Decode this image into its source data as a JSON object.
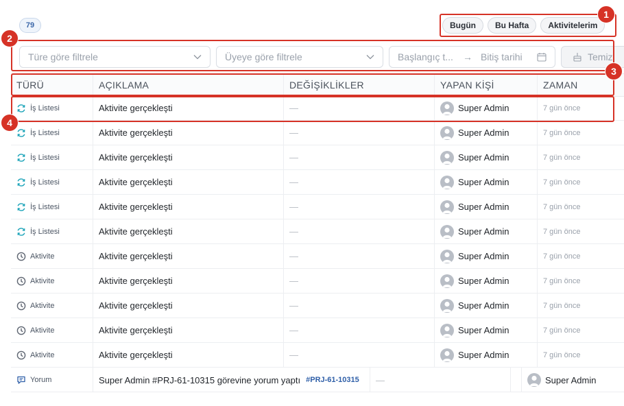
{
  "count_badge": "79",
  "quick_filters": [
    "Bugün",
    "Bu Hafta",
    "Aktivitelerim"
  ],
  "filters": {
    "type_placeholder": "Türe göre filtrele",
    "member_placeholder": "Üyeye göre filtrele",
    "start_date_placeholder": "Başlangıç t...",
    "end_date_placeholder": "Bitiş tarihi",
    "clear_label": "Temiz"
  },
  "table": {
    "headers": [
      "TÜRÜ",
      "AÇIKLAMA",
      "DEĞİŞİKLİKLER",
      "YAPAN KİŞİ",
      "ZAMAN"
    ],
    "rows": [
      {
        "type": "İş Listesi",
        "icon": "refresh-icon",
        "desc": "Aktivite gerçekleşti",
        "changes": "—",
        "user": "Super Admin",
        "time": "7 gün önce"
      },
      {
        "type": "İş Listesi",
        "icon": "refresh-icon",
        "desc": "Aktivite gerçekleşti",
        "changes": "—",
        "user": "Super Admin",
        "time": "7 gün önce"
      },
      {
        "type": "İş Listesi",
        "icon": "refresh-icon",
        "desc": "Aktivite gerçekleşti",
        "changes": "—",
        "user": "Super Admin",
        "time": "7 gün önce"
      },
      {
        "type": "İş Listesi",
        "icon": "refresh-icon",
        "desc": "Aktivite gerçekleşti",
        "changes": "—",
        "user": "Super Admin",
        "time": "7 gün önce"
      },
      {
        "type": "İş Listesi",
        "icon": "refresh-icon",
        "desc": "Aktivite gerçekleşti",
        "changes": "—",
        "user": "Super Admin",
        "time": "7 gün önce"
      },
      {
        "type": "İş Listesi",
        "icon": "refresh-icon",
        "desc": "Aktivite gerçekleşti",
        "changes": "—",
        "user": "Super Admin",
        "time": "7 gün önce"
      },
      {
        "type": "Aktivite",
        "icon": "clock-icon",
        "desc": "Aktivite gerçekleşti",
        "changes": "—",
        "user": "Super Admin",
        "time": "7 gün önce"
      },
      {
        "type": "Aktivite",
        "icon": "clock-icon",
        "desc": "Aktivite gerçekleşti",
        "changes": "—",
        "user": "Super Admin",
        "time": "7 gün önce"
      },
      {
        "type": "Aktivite",
        "icon": "clock-icon",
        "desc": "Aktivite gerçekleşti",
        "changes": "—",
        "user": "Super Admin",
        "time": "7 gün önce"
      },
      {
        "type": "Aktivite",
        "icon": "clock-icon",
        "desc": "Aktivite gerçekleşti",
        "changes": "—",
        "user": "Super Admin",
        "time": "7 gün önce"
      },
      {
        "type": "Aktivite",
        "icon": "clock-icon",
        "desc": "Aktivite gerçekleşti",
        "changes": "—",
        "user": "Super Admin",
        "time": "7 gün önce"
      }
    ],
    "comment_row": {
      "type": "Yorum",
      "icon": "comment-icon",
      "desc": "Super Admin #PRJ-61-10315 görevine yorum yaptı",
      "ref": "#PRJ-61-10315",
      "changes": "—",
      "user": "Super Admin"
    }
  },
  "annotations": [
    "1",
    "2",
    "3",
    "4"
  ],
  "colors": {
    "accent": "#d63226",
    "link": "#2f5fa8",
    "refresh_icon": "#1aa3b8",
    "clock_icon": "#5f6672"
  }
}
